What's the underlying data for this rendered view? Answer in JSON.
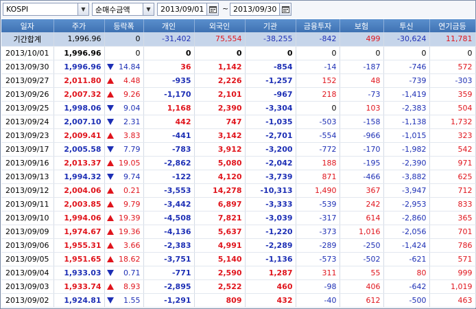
{
  "toolbar": {
    "index_value": "KOSPI",
    "type_value": "순매수금액",
    "start_date": "2013/09/01",
    "separator": "~",
    "end_date": "2013/09/30"
  },
  "columns": [
    "일자",
    "주가",
    "등락폭",
    "개인",
    "외국인",
    "기관",
    "금융투자",
    "보험",
    "투신",
    "연기금등"
  ],
  "colors": {
    "up": "#e0141c",
    "down": "#1d2fb5",
    "header": "#4a7fc0",
    "total_row": "#c6d5ea"
  },
  "rows": [
    {
      "date": "기간합계",
      "price": "1,996.96",
      "dir": "",
      "change": "0",
      "individual": "-31,402",
      "foreign": "75,554",
      "institution": "-38,255",
      "fin": "-842",
      "ins": "499",
      "trust": "-30,624",
      "pension": "11,781",
      "total": true
    },
    {
      "date": "2013/10/01",
      "price": "1,996.96",
      "dir": "",
      "change": "0",
      "individual": "0",
      "foreign": "0",
      "institution": "0",
      "fin": "0",
      "ins": "0",
      "trust": "0",
      "pension": "0"
    },
    {
      "date": "2013/09/30",
      "price": "1,996.96",
      "dir": "down",
      "change": "14.84",
      "individual": "36",
      "foreign": "1,142",
      "institution": "-854",
      "fin": "-14",
      "ins": "-187",
      "trust": "-746",
      "pension": "572"
    },
    {
      "date": "2013/09/27",
      "price": "2,011.80",
      "dir": "up",
      "change": "4.48",
      "individual": "-935",
      "foreign": "2,226",
      "institution": "-1,257",
      "fin": "152",
      "ins": "48",
      "trust": "-739",
      "pension": "-303"
    },
    {
      "date": "2013/09/26",
      "price": "2,007.32",
      "dir": "up",
      "change": "9.26",
      "individual": "-1,170",
      "foreign": "2,101",
      "institution": "-967",
      "fin": "218",
      "ins": "-73",
      "trust": "-1,419",
      "pension": "359"
    },
    {
      "date": "2013/09/25",
      "price": "1,998.06",
      "dir": "down",
      "change": "9.04",
      "individual": "1,168",
      "foreign": "2,390",
      "institution": "-3,304",
      "fin": "0",
      "ins": "103",
      "trust": "-2,383",
      "pension": "504"
    },
    {
      "date": "2013/09/24",
      "price": "2,007.10",
      "dir": "down",
      "change": "2.31",
      "individual": "442",
      "foreign": "747",
      "institution": "-1,035",
      "fin": "-503",
      "ins": "-158",
      "trust": "-1,138",
      "pension": "1,732"
    },
    {
      "date": "2013/09/23",
      "price": "2,009.41",
      "dir": "up",
      "change": "3.83",
      "individual": "-441",
      "foreign": "3,142",
      "institution": "-2,701",
      "fin": "-554",
      "ins": "-966",
      "trust": "-1,015",
      "pension": "323"
    },
    {
      "date": "2013/09/17",
      "price": "2,005.58",
      "dir": "down",
      "change": "7.79",
      "individual": "-783",
      "foreign": "3,912",
      "institution": "-3,200",
      "fin": "-772",
      "ins": "-170",
      "trust": "-1,982",
      "pension": "542"
    },
    {
      "date": "2013/09/16",
      "price": "2,013.37",
      "dir": "up",
      "change": "19.05",
      "individual": "-2,862",
      "foreign": "5,080",
      "institution": "-2,042",
      "fin": "188",
      "ins": "-195",
      "trust": "-2,390",
      "pension": "971"
    },
    {
      "date": "2013/09/13",
      "price": "1,994.32",
      "dir": "down",
      "change": "9.74",
      "individual": "-122",
      "foreign": "4,120",
      "institution": "-3,739",
      "fin": "871",
      "ins": "-466",
      "trust": "-3,882",
      "pension": "625"
    },
    {
      "date": "2013/09/12",
      "price": "2,004.06",
      "dir": "up",
      "change": "0.21",
      "individual": "-3,553",
      "foreign": "14,278",
      "institution": "-10,313",
      "fin": "1,490",
      "ins": "367",
      "trust": "-3,947",
      "pension": "712"
    },
    {
      "date": "2013/09/11",
      "price": "2,003.85",
      "dir": "up",
      "change": "9.79",
      "individual": "-3,442",
      "foreign": "6,897",
      "institution": "-3,333",
      "fin": "-539",
      "ins": "242",
      "trust": "-2,953",
      "pension": "833"
    },
    {
      "date": "2013/09/10",
      "price": "1,994.06",
      "dir": "up",
      "change": "19.39",
      "individual": "-4,508",
      "foreign": "7,821",
      "institution": "-3,039",
      "fin": "-317",
      "ins": "614",
      "trust": "-2,860",
      "pension": "365"
    },
    {
      "date": "2013/09/09",
      "price": "1,974.67",
      "dir": "up",
      "change": "19.36",
      "individual": "-4,136",
      "foreign": "5,637",
      "institution": "-1,220",
      "fin": "-373",
      "ins": "1,016",
      "trust": "-2,056",
      "pension": "701"
    },
    {
      "date": "2013/09/06",
      "price": "1,955.31",
      "dir": "up",
      "change": "3.66",
      "individual": "-2,383",
      "foreign": "4,991",
      "institution": "-2,289",
      "fin": "-289",
      "ins": "-250",
      "trust": "-1,424",
      "pension": "786"
    },
    {
      "date": "2013/09/05",
      "price": "1,951.65",
      "dir": "up",
      "change": "18.62",
      "individual": "-3,751",
      "foreign": "5,140",
      "institution": "-1,136",
      "fin": "-573",
      "ins": "-502",
      "trust": "-621",
      "pension": "571"
    },
    {
      "date": "2013/09/04",
      "price": "1,933.03",
      "dir": "down",
      "change": "0.71",
      "individual": "-771",
      "foreign": "2,590",
      "institution": "1,287",
      "fin": "311",
      "ins": "55",
      "trust": "80",
      "pension": "999"
    },
    {
      "date": "2013/09/03",
      "price": "1,933.74",
      "dir": "up",
      "change": "8.93",
      "individual": "-2,895",
      "foreign": "2,522",
      "institution": "460",
      "fin": "-98",
      "ins": "406",
      "trust": "-642",
      "pension": "1,019"
    },
    {
      "date": "2013/09/02",
      "price": "1,924.81",
      "dir": "down",
      "change": "1.55",
      "individual": "-1,291",
      "foreign": "809",
      "institution": "432",
      "fin": "-40",
      "ins": "612",
      "trust": "-500",
      "pension": "463"
    }
  ]
}
